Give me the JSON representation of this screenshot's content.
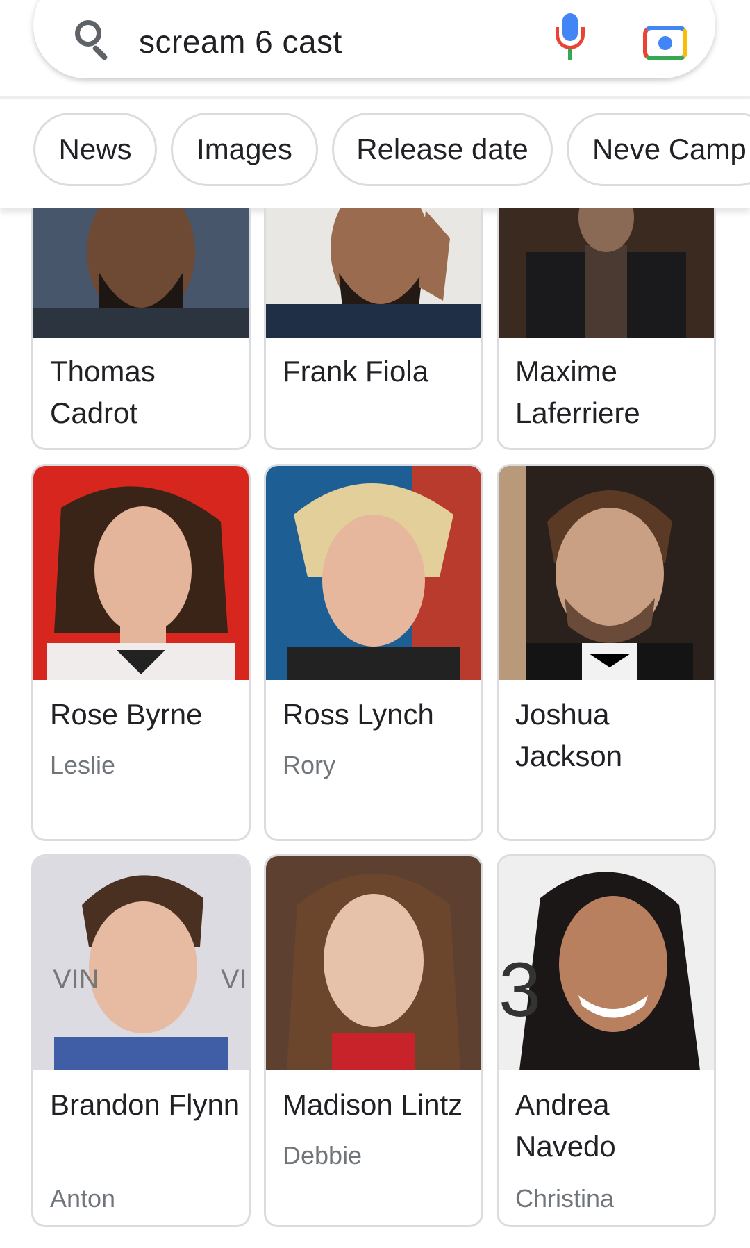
{
  "search": {
    "query": "scream 6 cast"
  },
  "chips": [
    "News",
    "Images",
    "Release date",
    "Neve Camp"
  ],
  "cast": [
    {
      "name": "Thomas Cadrot",
      "role": ""
    },
    {
      "name": "Frank Fiola",
      "role": ""
    },
    {
      "name": "Maxime Laferriere",
      "role": ""
    },
    {
      "name": "Rose Byrne",
      "role": "Leslie"
    },
    {
      "name": "Ross Lynch",
      "role": "Rory"
    },
    {
      "name": "Joshua Jackson",
      "role": ""
    },
    {
      "name": "Brandon Flynn",
      "role": "Anton"
    },
    {
      "name": "Madison Lintz",
      "role": "Debbie"
    },
    {
      "name": "Andrea Navedo",
      "role": "Christina"
    }
  ],
  "colors": {
    "google_blue": "#4285f4",
    "google_red": "#ea4335",
    "google_yellow": "#fbbc04",
    "google_green": "#34a853"
  }
}
